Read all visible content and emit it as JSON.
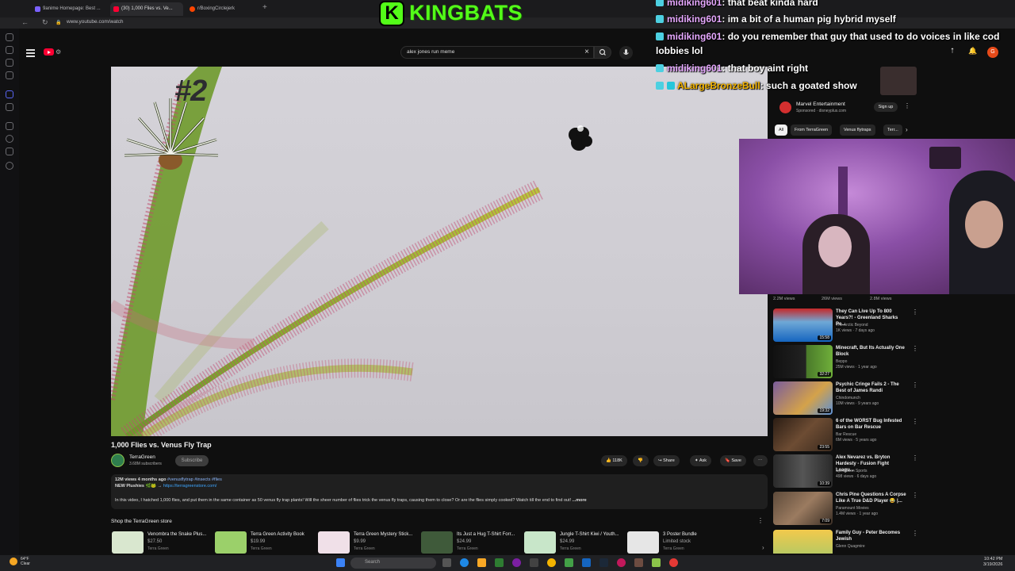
{
  "browser": {
    "tabs": [
      {
        "label": "9anime Homepage: Best ...",
        "color": "#7b61ff"
      },
      {
        "label": "(30) 1,000 Flies vs. Ve...",
        "color": "#ff0033"
      },
      {
        "label": "r/BoxingCirclejerk",
        "color": "#ff4500"
      }
    ],
    "url": "www.youtube.com/watch"
  },
  "youtube": {
    "search_value": "alex jones run  meme",
    "avatar_letter": "G"
  },
  "overlay": {
    "logo_letter": "K",
    "logo_text": "KINGBATS",
    "rank_text": "#2",
    "chat": [
      {
        "user": "midiking601",
        "message": ": that beat kinda hard"
      },
      {
        "user": "midiking601",
        "message": ": im a bit of a human pig hybrid myself"
      },
      {
        "user": "midiking601",
        "message": ": do you remember that guy that used to do voices in like cod"
      },
      {
        "user": "",
        "message": "lobbies lol"
      },
      {
        "user": "midiking601",
        "message": ": that boy aint right"
      },
      {
        "user": "ALargeBronzeBull",
        "message": ": such a goated show"
      }
    ]
  },
  "video": {
    "title": "1,000 Flies vs. Venus Fly Trap",
    "channel": "TerraGreen",
    "subscribers": "3.68M subscribers",
    "subscribe_label": "Subscribe",
    "likes": "118K",
    "share_label": "Share",
    "ask_label": "Ask",
    "save_label": "Save",
    "meta": "12M views  4 months ago",
    "meta_tags": "#venusflytrap #insects #flies",
    "plushies_label": "NEW Plushies",
    "plushies_link": "https://terragreenstore.com/",
    "description": "In this video, I hatched 1,000 flies, and put them in the same container as 50 venus fly trap plants! Will the sheer number of flies trick the venus fly traps, causing them to close? Or are the flies simply cooked? Watch till the end to find out!",
    "more_label": "...more"
  },
  "store": {
    "title": "Shop the TerraGreen store",
    "products": [
      {
        "name": "Venombra the Snake Plus...",
        "price": "$27.50",
        "seller": "Terra Green"
      },
      {
        "name": "Terra Green Activity Book",
        "price": "$19.99",
        "seller": "Terra Green"
      },
      {
        "name": "Terra Green Mystery Stick...",
        "price": "$9.99",
        "seller": "Terra Green"
      },
      {
        "name": "Its Just a Hug T-Shirt Forr...",
        "price": "$24.99",
        "seller": "Terra Green"
      },
      {
        "name": "Jungle T-Shirt Kiwi / Youth...",
        "price": "$24.99",
        "seller": "Terra Green"
      },
      {
        "name": "3 Poster Bundle",
        "price": "Limited stock",
        "seller": "Terra Green"
      }
    ]
  },
  "ad": {
    "name": "Marvel Entertainment",
    "sponsored": "Sponsored · disneyplus.com",
    "signup": "Sign up"
  },
  "chips": [
    "All",
    "From TerraGreen",
    "Venus flytraps",
    "Terr..."
  ],
  "views_row": [
    "2.2M views",
    "26M views",
    "2.8M views"
  ],
  "recommendations": [
    {
      "title": "They Can Live Up To 800 Years?! - Greenland Sharks Pe...",
      "channel": "The Arctic Beyond",
      "meta": "1K views · 7 days ago",
      "duration": "15:58",
      "thumb": "#6fa8d6"
    },
    {
      "title": "Minecraft, But Its Actually One Block",
      "channel": "Beppo",
      "meta": "25M views · 1 year ago",
      "duration": "32:27",
      "thumb": "#2d2d2d"
    },
    {
      "title": "Psychic Cringe Fails 2 - The Best of James Randi",
      "channel": "Chindomunch",
      "meta": "10M views · 9 years ago",
      "duration": "19:32",
      "thumb": "#7a5c9b"
    },
    {
      "title": "6 of the WORST Bug Infested Bars on Bar Rescue",
      "channel": "Bar Rescue",
      "meta": "6M views · 5 years ago",
      "duration": "23:55",
      "thumb": "#4a3728"
    },
    {
      "title": "Alex Nevarez vs. Bryton Hardesty - Fusion Fight Leagu...",
      "channel": "Spectation Sports",
      "meta": "498 views · 6 days ago",
      "duration": "10:39",
      "thumb": "#3b3b3b"
    },
    {
      "title": "Chris Pine Questions A Corpse Like A True D&D Player 😂 |...",
      "channel": "Paramount Movies",
      "meta": "1.4M views · 1 year ago",
      "duration": "7:09",
      "thumb": "#5d4a3a"
    },
    {
      "title": "Family Guy - Peter Becomes Jewish",
      "channel": "Glenn Quagmire",
      "meta": "",
      "duration": "",
      "thumb": "#f2c94c"
    }
  ],
  "taskbar": {
    "temp": "64°F",
    "cond": "Clear",
    "search_placeholder": "Search",
    "time": "10:42 PM",
    "date": "3/19/2026"
  }
}
